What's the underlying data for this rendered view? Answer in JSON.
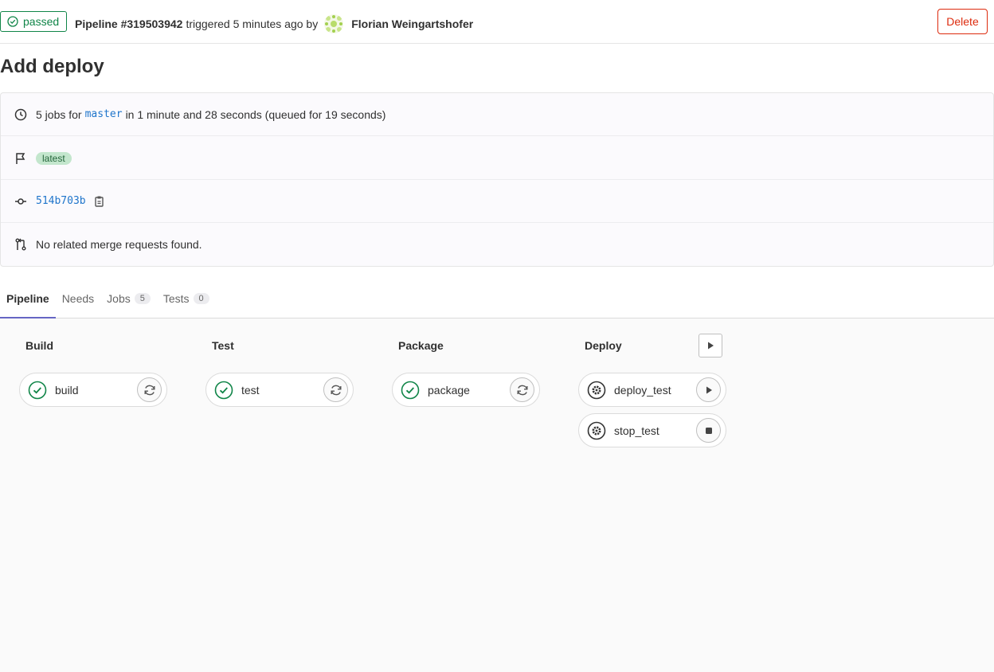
{
  "header": {
    "status_label": "passed",
    "pipeline_label": "Pipeline #319503942",
    "triggered_text": "triggered 5 minutes ago by",
    "user_name": "Florian Weingartshofer",
    "delete_label": "Delete"
  },
  "title": "Add deploy",
  "info": {
    "jobs_prefix": "5 jobs for",
    "branch": "master",
    "duration_text": "in 1 minute and 28 seconds (queued for 19 seconds)",
    "tag_label": "latest",
    "commit_sha": "514b703b",
    "merge_requests_text": "No related merge requests found."
  },
  "tabs": [
    {
      "label": "Pipeline"
    },
    {
      "label": "Needs"
    },
    {
      "label": "Jobs",
      "count": "5"
    },
    {
      "label": "Tests",
      "count": "0"
    }
  ],
  "stages": [
    {
      "name": "Build",
      "jobs": [
        {
          "name": "build",
          "status": "success",
          "action": "retry-icon"
        }
      ]
    },
    {
      "name": "Test",
      "jobs": [
        {
          "name": "test",
          "status": "success",
          "action": "retry-icon"
        }
      ]
    },
    {
      "name": "Package",
      "jobs": [
        {
          "name": "package",
          "status": "success",
          "action": "retry-icon"
        }
      ]
    },
    {
      "name": "Deploy",
      "jobs": [
        {
          "name": "deploy_test",
          "status": "manual",
          "action": "play-icon"
        },
        {
          "name": "stop_test",
          "status": "manual",
          "action": "stop-icon"
        }
      ]
    }
  ],
  "colors": {
    "success": "#108548",
    "danger": "#dd2b0e",
    "link": "#1f75cb",
    "tab_active": "#6666c4"
  }
}
